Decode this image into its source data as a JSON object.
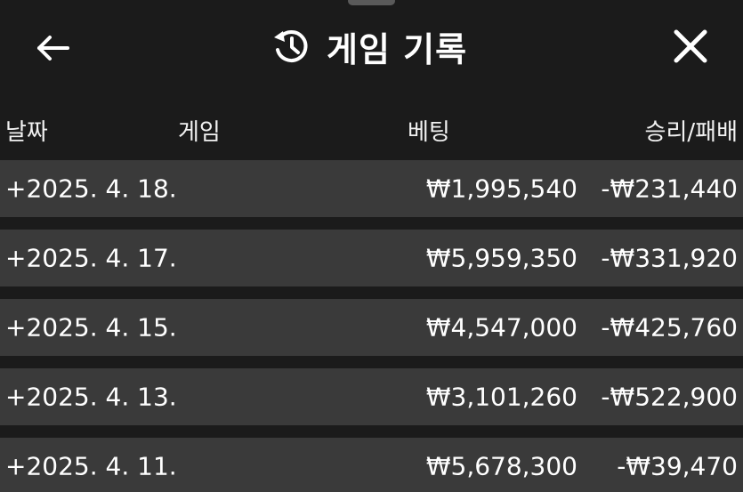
{
  "header": {
    "title": "게임 기록",
    "icons": {
      "back": "arrow-left-icon",
      "history": "history-icon",
      "close": "close-icon"
    }
  },
  "columns": {
    "date": "날짜",
    "game": "게임",
    "bet": "베팅",
    "result": "승리/패배"
  },
  "rows": [
    {
      "date": "+2025. 4. 18.",
      "game": "",
      "bet": "₩1,995,540",
      "result": "-₩231,440"
    },
    {
      "date": "+2025. 4. 17.",
      "game": "",
      "bet": "₩5,959,350",
      "result": "-₩331,920"
    },
    {
      "date": "+2025. 4. 15.",
      "game": "",
      "bet": "₩4,547,000",
      "result": "-₩425,760"
    },
    {
      "date": "+2025. 4. 13.",
      "game": "",
      "bet": "₩3,101,260",
      "result": "-₩522,900"
    },
    {
      "date": "+2025. 4. 11.",
      "game": "",
      "bet": "₩5,678,300",
      "result": "-₩39,470"
    }
  ],
  "colors": {
    "background": "#1b1b1b",
    "row_background": "#3a3a3a",
    "text": "#ffffff"
  }
}
